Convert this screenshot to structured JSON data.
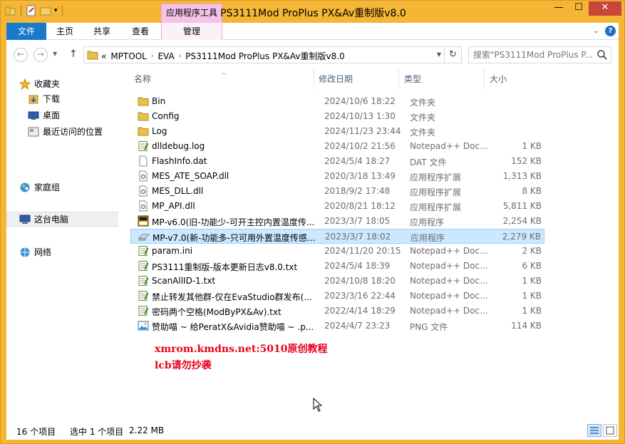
{
  "window": {
    "title": "PS3111Mod ProPlus PX&Av重制版v8.0",
    "context_tab_header": "应用程序工具",
    "buttons": {
      "minimize": "—",
      "maximize": "☐",
      "close": "✕"
    }
  },
  "ribbon": {
    "tabs": {
      "file": "文件",
      "home": "主页",
      "share": "共享",
      "view": "查看",
      "manage": "管理"
    },
    "help": "?"
  },
  "address": {
    "prefix": "«",
    "crumbs": [
      "MPTOOL",
      "EVA",
      "PS3111Mod ProPlus PX&Av重制版v8.0"
    ],
    "search_placeholder": "搜索\"PS3111Mod ProPlus P..."
  },
  "nav": {
    "favorites": "收藏夹",
    "downloads": "下载",
    "desktop": "桌面",
    "recent": "最近访问的位置",
    "homegroup": "家庭组",
    "this_pc": "这台电脑",
    "network": "网络"
  },
  "columns": {
    "name": "名称",
    "date": "修改日期",
    "type": "类型",
    "size": "大小"
  },
  "files": [
    {
      "name": "Bin",
      "date": "2024/10/6 18:22",
      "type": "文件夹",
      "size": "",
      "icon": "folder"
    },
    {
      "name": "Config",
      "date": "2024/10/13 1:30",
      "type": "文件夹",
      "size": "",
      "icon": "folder"
    },
    {
      "name": "Log",
      "date": "2024/11/23 23:44",
      "type": "文件夹",
      "size": "",
      "icon": "folder"
    },
    {
      "name": "dlldebug.log",
      "date": "2024/10/2 21:56",
      "type": "Notepad++ Doc...",
      "size": "1 KB",
      "icon": "notepad"
    },
    {
      "name": "FlashInfo.dat",
      "date": "2024/5/4 18:27",
      "type": "DAT 文件",
      "size": "152 KB",
      "icon": "file"
    },
    {
      "name": "MES_ATE_SOAP.dll",
      "date": "2020/3/18 13:49",
      "type": "应用程序扩展",
      "size": "1,313 KB",
      "icon": "dll"
    },
    {
      "name": "MES_DLL.dll",
      "date": "2018/9/2 17:48",
      "type": "应用程序扩展",
      "size": "8 KB",
      "icon": "dll"
    },
    {
      "name": "MP_API.dll",
      "date": "2020/8/21 18:12",
      "type": "应用程序扩展",
      "size": "5,811 KB",
      "icon": "dll"
    },
    {
      "name": "MP-v6.0(旧-功能少-可开主控内置温度传...",
      "date": "2023/3/7 18:05",
      "type": "应用程序",
      "size": "2,254 KB",
      "icon": "sata"
    },
    {
      "name": "MP-v7.0(新-功能多-只可用外置温度传感...",
      "date": "2023/3/7 18:02",
      "type": "应用程序",
      "size": "2,279 KB",
      "icon": "ssd",
      "selected": true
    },
    {
      "name": "param.ini",
      "date": "2024/11/20 20:15",
      "type": "Notepad++ Doc...",
      "size": "2 KB",
      "icon": "notepad"
    },
    {
      "name": "PS3111重制版-版本更新日志v8.0.txt",
      "date": "2024/5/4 18:39",
      "type": "Notepad++ Doc...",
      "size": "6 KB",
      "icon": "notepad"
    },
    {
      "name": "ScanAllID-1.txt",
      "date": "2024/10/8 18:20",
      "type": "Notepad++ Doc...",
      "size": "1 KB",
      "icon": "notepad"
    },
    {
      "name": "禁止转发其他群-仅在EvaStudio群发布(...",
      "date": "2023/3/16 22:44",
      "type": "Notepad++ Doc...",
      "size": "1 KB",
      "icon": "notepad"
    },
    {
      "name": "密码两个空格(ModByPX&Av).txt",
      "date": "2022/4/14 18:29",
      "type": "Notepad++ Doc...",
      "size": "1 KB",
      "icon": "notepad"
    },
    {
      "name": "赞助喵 ~ 给PeratX&Avidia赞助喵 ~ .p...",
      "date": "2024/4/7 23:23",
      "type": "PNG 文件",
      "size": "114 KB",
      "icon": "image"
    }
  ],
  "watermark": {
    "line1": "xmrom.kmdns.net:5010原创教程",
    "line2": "lcb请勿抄袭"
  },
  "status": {
    "count": "16 个项目",
    "selection": "选中 1 个项目",
    "size": "2.22 MB"
  },
  "colors": {
    "frame": "#f5b535",
    "file_tab": "#1979ca",
    "selected_row": "#cce8ff",
    "watermark": "#e8001c"
  }
}
